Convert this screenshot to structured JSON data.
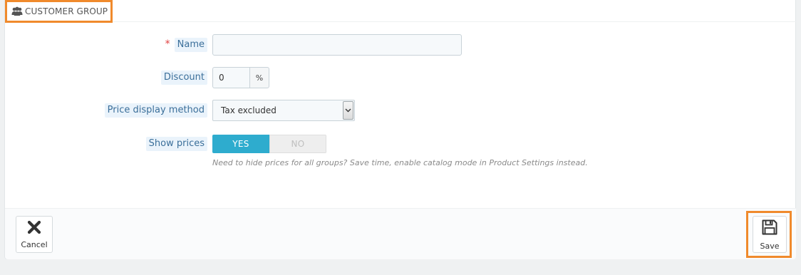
{
  "panel": {
    "title": "CUSTOMER GROUP",
    "icon": "users-icon"
  },
  "form": {
    "name": {
      "label": "Name",
      "required_marker": "*",
      "value": "",
      "required": true
    },
    "discount": {
      "label": "Discount",
      "value": "0",
      "suffix": "%"
    },
    "price_display_method": {
      "label": "Price display method",
      "selected": "Tax excluded"
    },
    "show_prices": {
      "label": "Show prices",
      "yes_label": "YES",
      "no_label": "NO",
      "selected": "YES",
      "help": "Need to hide prices for all groups? Save time, enable catalog mode in Product Settings instead."
    }
  },
  "footer": {
    "cancel_label": "Cancel",
    "cancel_icon": "close-icon",
    "save_label": "Save",
    "save_icon": "floppy-disk-icon"
  },
  "colors": {
    "accent": "#2eacce",
    "highlight": "#f08a2c",
    "label_text": "#3b6f9a",
    "label_bg": "#eaf3fb",
    "required": "#e04040"
  }
}
